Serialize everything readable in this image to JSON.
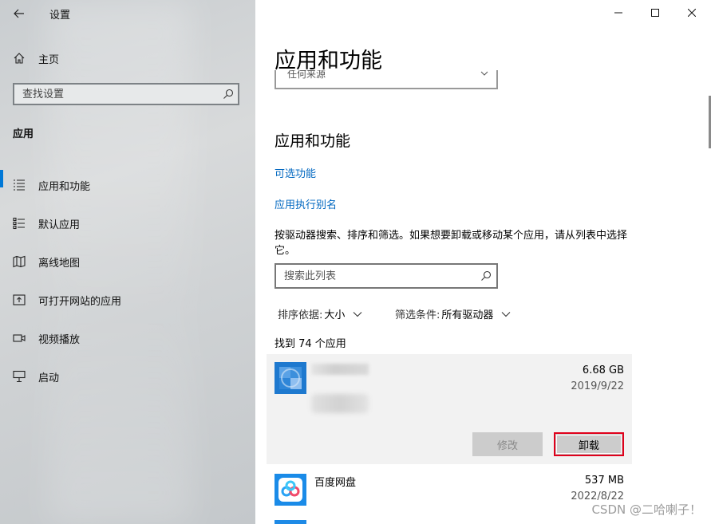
{
  "sidebar": {
    "title": "设置",
    "home_label": "主页",
    "search_placeholder": "查找设置",
    "section_label": "应用",
    "items": [
      {
        "label": "应用和功能",
        "icon": "apps-features-icon",
        "selected": true
      },
      {
        "label": "默认应用",
        "icon": "default-apps-icon",
        "selected": false
      },
      {
        "label": "离线地图",
        "icon": "offline-maps-icon",
        "selected": false
      },
      {
        "label": "可打开网站的应用",
        "icon": "apps-for-websites-icon",
        "selected": false
      },
      {
        "label": "视频播放",
        "icon": "video-playback-icon",
        "selected": false
      },
      {
        "label": "启动",
        "icon": "startup-icon",
        "selected": false
      }
    ]
  },
  "main": {
    "page_title": "应用和功能",
    "source_dropdown_value": "任何来源",
    "section_heading": "应用和功能",
    "link_optional_features": "可选功能",
    "link_app_aliases": "应用执行别名",
    "description": "按驱动器搜索、排序和筛选。如果想要卸载或移动某个应用，请从列表中选择它。",
    "list_search_placeholder": "搜索此列表",
    "sort_label": "排序依据:",
    "sort_value": "大小",
    "filter_label": "筛选条件:",
    "filter_value": "所有驱动器",
    "count_text": "找到 74 个应用",
    "apps": [
      {
        "name": "",
        "size": "6.68 GB",
        "date": "2019/9/22",
        "modify_label": "修改",
        "uninstall_label": "卸载",
        "expanded": true
      },
      {
        "name": "百度网盘",
        "size": "537 MB",
        "date": "2022/8/22",
        "expanded": false
      }
    ]
  },
  "window": {
    "minimize": "minimize-icon",
    "maximize": "maximize-icon",
    "close": "close-icon"
  },
  "watermark": "CSDN @二哈喇子！",
  "colors": {
    "accent": "#0078d7",
    "link": "#0067c0",
    "highlight_border": "#e0001b"
  }
}
